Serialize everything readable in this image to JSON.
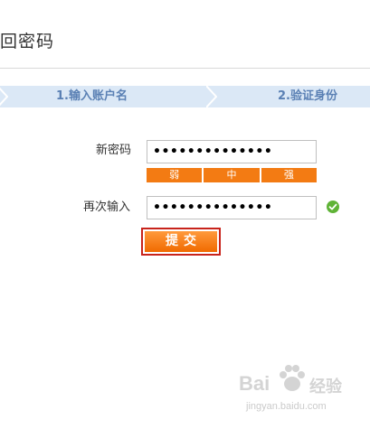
{
  "header": {
    "title": "回密码"
  },
  "steps": [
    {
      "label": "1.输入账户名"
    },
    {
      "label": "2.验证身份"
    }
  ],
  "form": {
    "new_password_label": "新密码",
    "new_password_value": "••••••••••••••",
    "strength_levels": [
      "弱",
      "中",
      "强"
    ],
    "confirm_label": "再次输入",
    "confirm_value": "••••••••••••••",
    "submit_label": "提交"
  },
  "watermark": {
    "brand": "Bai",
    "brand_tail": "经验",
    "url": "jingyan.baidu.com"
  },
  "colors": {
    "step_bar": "#dbe8f6",
    "step_text": "#5a80b4",
    "strength_orange": "#f37b13",
    "submit_border": "#c8231b",
    "check_green": "#5fb336"
  },
  "icons": {
    "valid": "check-circle-icon",
    "watermark": "paw-icon"
  }
}
